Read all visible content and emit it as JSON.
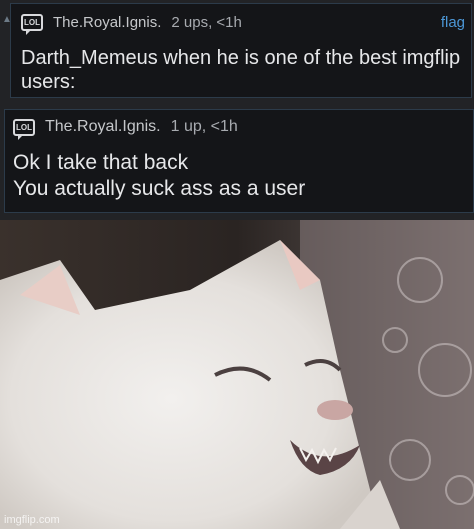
{
  "comments": [
    {
      "username": "The.Royal.Ignis.",
      "votes": "2 ups, <1h",
      "flag_label": "flag",
      "text": "Darth_Memeus when he is one of the best imgflip\nusers:"
    },
    {
      "username": "The.Royal.Ignis.",
      "votes": "1 up, <1h",
      "text": "Ok I take that back\nYou actually suck ass as a user"
    }
  ],
  "icons": {
    "lol_badge_text": "LOL",
    "lol_badge_icon": "lol-speech-bubble-icon"
  },
  "image": {
    "description_icon": "laughing-cat-photo",
    "watermark": "imgflip.com"
  },
  "colors": {
    "comment_bg": "#141518",
    "comment_border": "#2c3b4a",
    "flag": "#4c97d6",
    "text": "#e6e7e9",
    "meta": "#a8abb0"
  }
}
